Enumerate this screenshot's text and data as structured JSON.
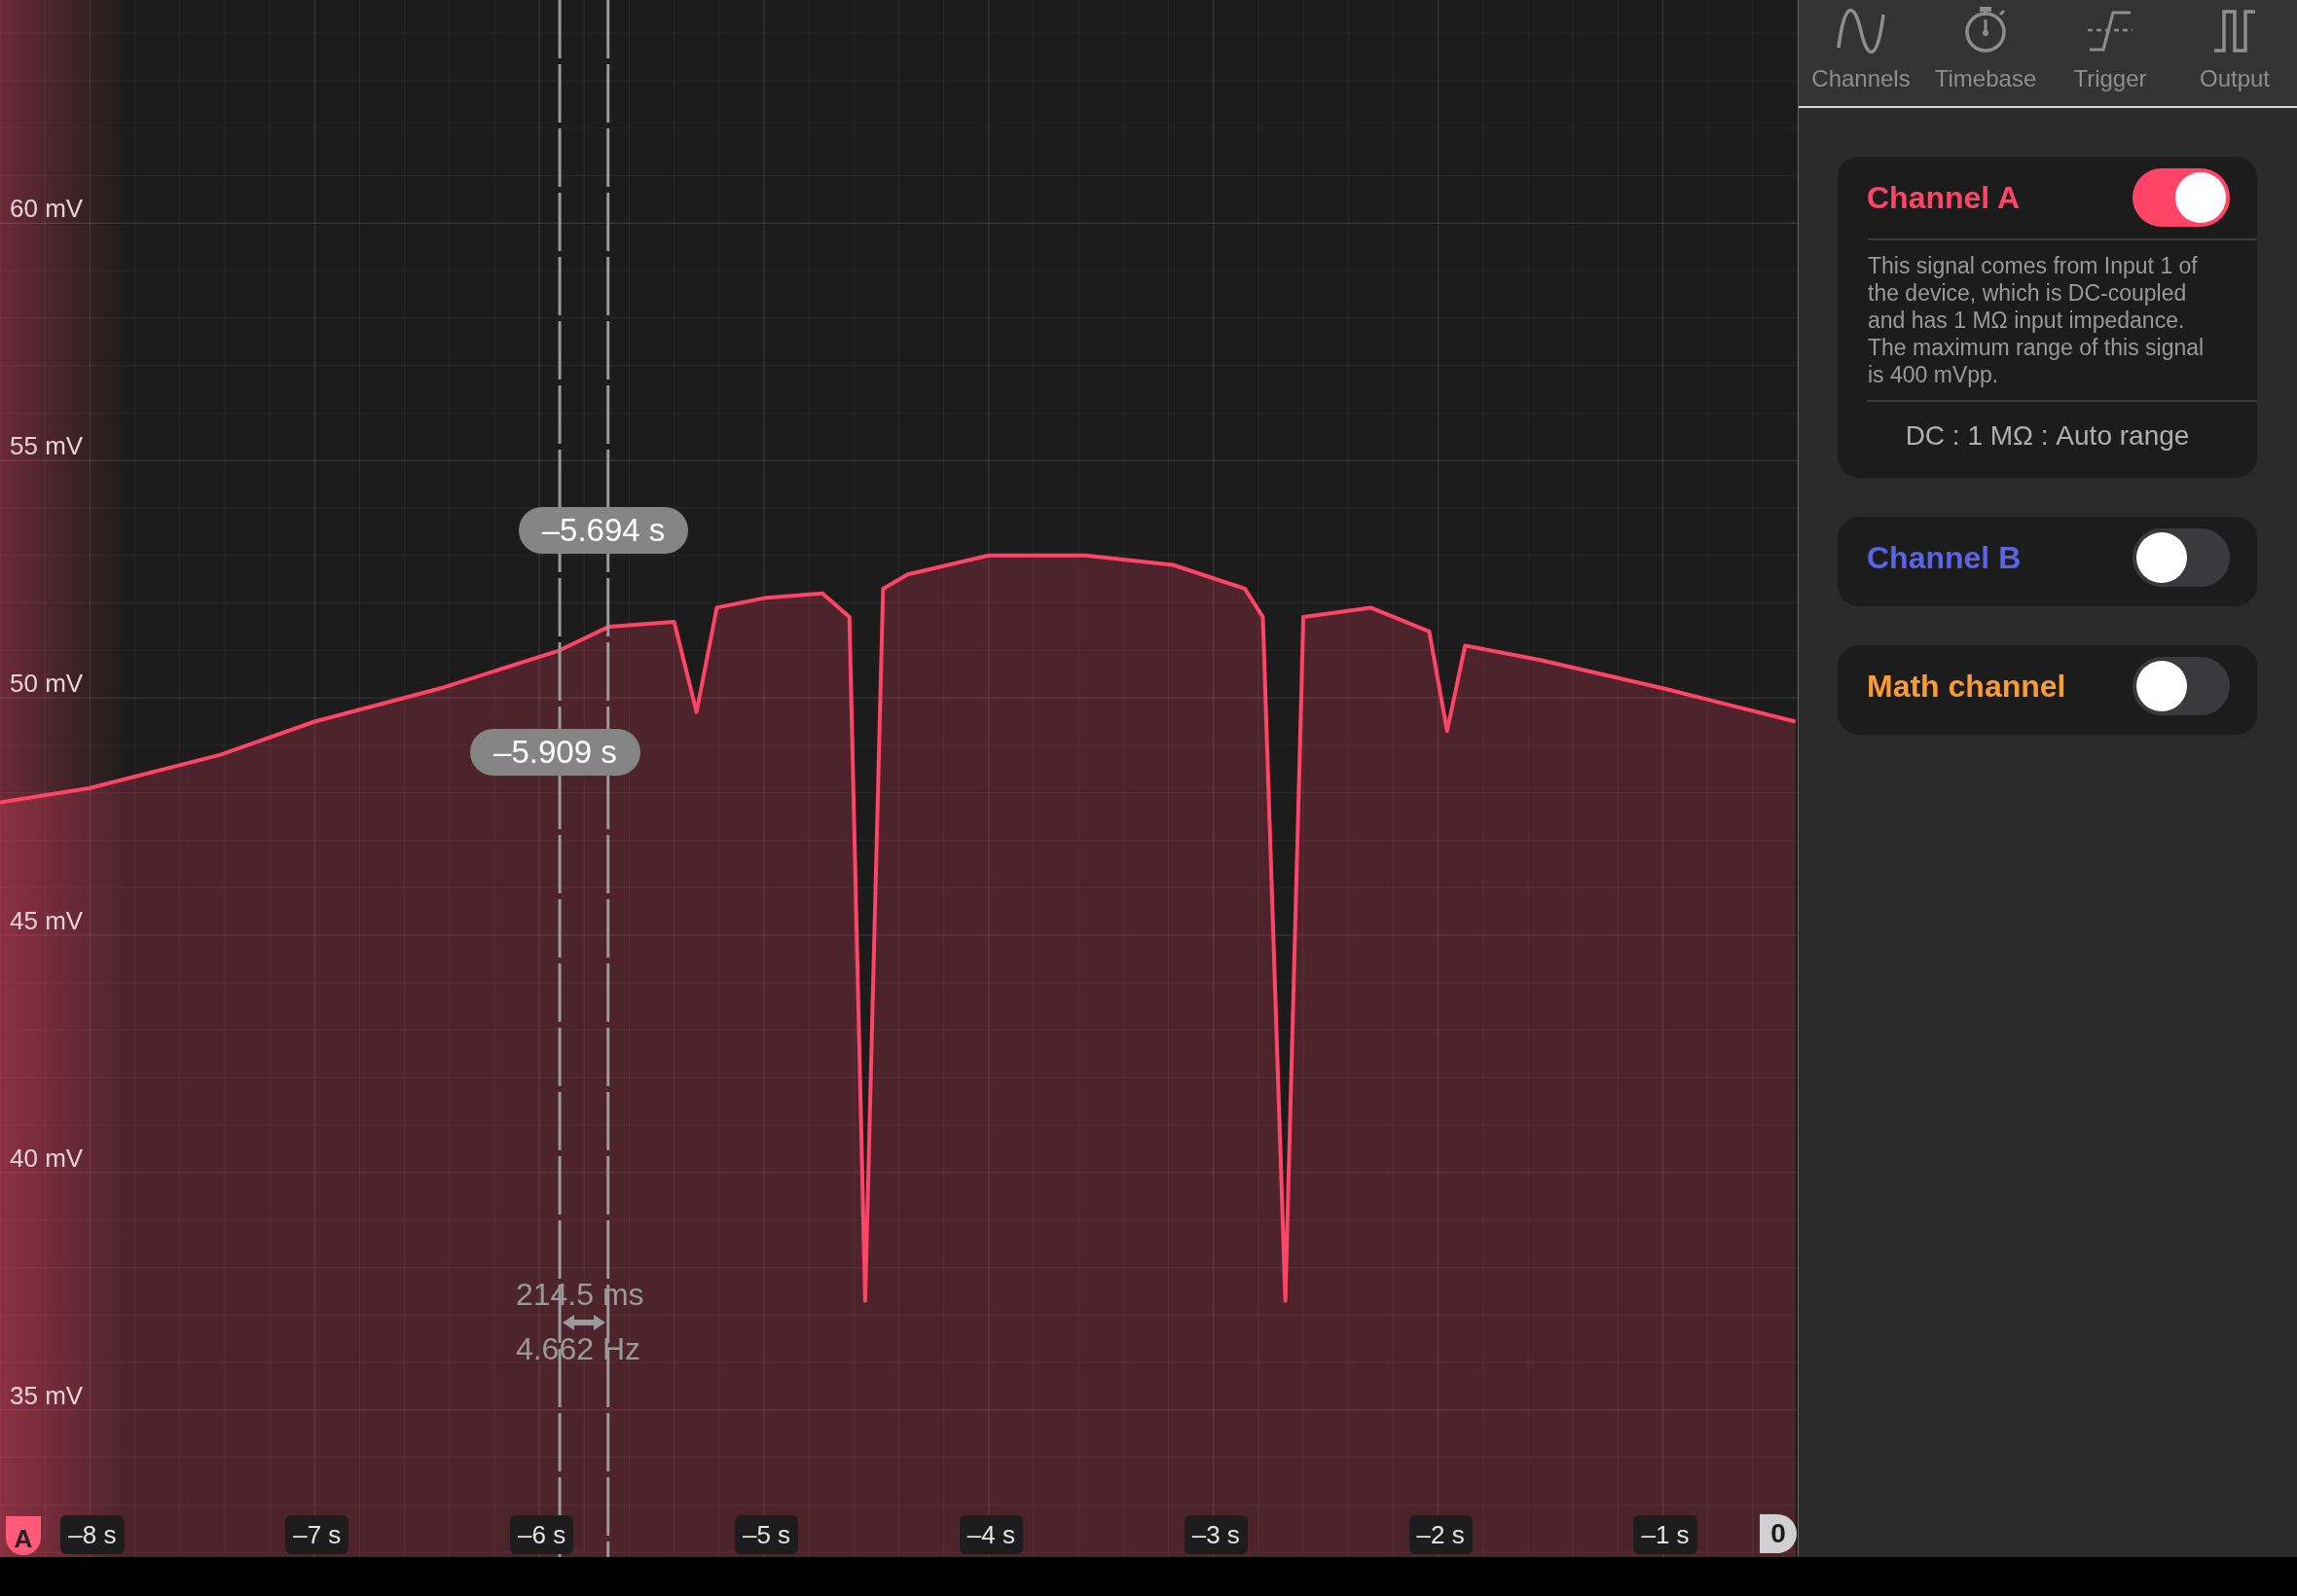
{
  "toolbar": {
    "tabs": [
      {
        "label": "Channels",
        "kind": "sine"
      },
      {
        "label": "Timebase",
        "kind": "stopwatch"
      },
      {
        "label": "Trigger",
        "kind": "trigger"
      },
      {
        "label": "Output",
        "kind": "pulse"
      }
    ]
  },
  "channels": [
    {
      "name": "Channel A",
      "color": "#ff4468",
      "on": true,
      "description": "This signal comes from Input 1 of the device, which is DC-coupled and has 1 MΩ input impedance. The maximum range of this signal is 400 mVpp.",
      "setting": "DC : 1 MΩ : Auto range"
    },
    {
      "name": "Channel B",
      "color": "#5b63e8",
      "on": false
    },
    {
      "name": "Math channel",
      "color": "#fb9b32",
      "on": false
    }
  ],
  "scope": {
    "channel_marker": "A",
    "trigger_marker": "0",
    "cursors": [
      {
        "label": "–5.694 s"
      },
      {
        "label": "–5.909 s"
      }
    ],
    "measurement": {
      "period": "214.5 ms",
      "frequency": "4.662 Hz"
    },
    "chart_data": {
      "type": "area",
      "grid": true,
      "xlim": [
        -8.4,
        -0.4
      ],
      "ylim": [
        31.9,
        64.7
      ],
      "ref_lines": [
        {
          "axis": "x",
          "value": -5.694
        },
        {
          "axis": "x",
          "value": -5.909
        }
      ],
      "xticks": [
        {
          "value": -8,
          "label": "–8 s"
        },
        {
          "value": -7,
          "label": "–7 s"
        },
        {
          "value": -6,
          "label": "–6 s"
        },
        {
          "value": -5,
          "label": "–5 s"
        },
        {
          "value": -4,
          "label": "–4 s"
        },
        {
          "value": -3,
          "label": "–3 s"
        },
        {
          "value": -2,
          "label": "–2 s"
        },
        {
          "value": -1,
          "label": "–1 s"
        }
      ],
      "yticks": [
        {
          "value": 60,
          "label": "60 mV"
        },
        {
          "value": 55,
          "label": "55 mV"
        },
        {
          "value": 50,
          "label": "50 mV"
        },
        {
          "value": 45,
          "label": "45 mV"
        },
        {
          "value": 40,
          "label": "40 mV"
        },
        {
          "value": 35,
          "label": "35 mV"
        }
      ],
      "x": [
        -8.4,
        -8.0,
        -7.42,
        -7.0,
        -6.44,
        -5.91,
        -5.69,
        -5.4,
        -5.3,
        -5.21,
        -5.0,
        -4.74,
        -4.62,
        -4.55,
        -4.47,
        -4.36,
        -4.0,
        -3.57,
        -3.18,
        -2.86,
        -2.78,
        -2.68,
        -2.6,
        -2.3,
        -2.04,
        -1.96,
        -1.88,
        -1.55,
        -1.0,
        -0.41
      ],
      "series": [
        {
          "color": "#ff4468",
          "values": [
            47.8,
            48.1,
            48.8,
            49.5,
            50.2,
            51.0,
            51.5,
            51.6,
            49.7,
            51.9,
            52.1,
            52.2,
            51.7,
            37.3,
            52.3,
            52.6,
            53.0,
            53.0,
            52.8,
            52.3,
            51.7,
            37.3,
            51.7,
            51.9,
            51.4,
            49.3,
            51.1,
            50.8,
            50.2,
            49.5
          ]
        }
      ]
    }
  }
}
